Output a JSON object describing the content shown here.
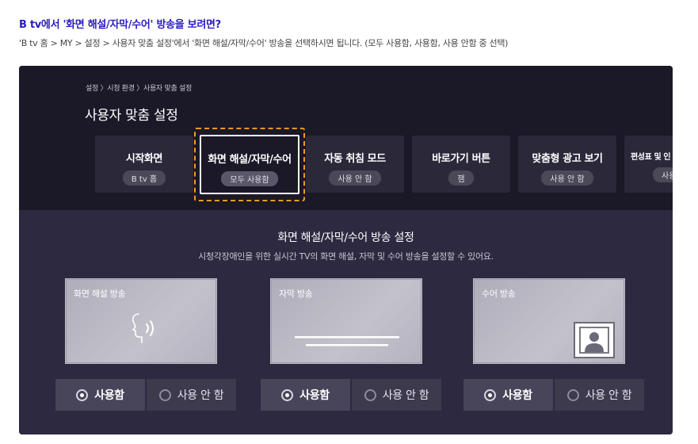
{
  "article": {
    "heading": "B tv에서 '화면 해설/자막/수어' 방송을 보려면?",
    "subtext": "'B tv 홈 > MY > 설정 > 사용자 맞춤 설정'에서 '화면 해설/자막/수어' 방송을 선택하시면 됩니다. (모두 사용함, 사용함, 사용 안함 중 선택)"
  },
  "tv": {
    "breadcrumb": "설정 〉시청 환경 〉사용자 맞춤 설정",
    "title": "사용자 맞춤 설정",
    "menu": [
      {
        "label": "시작화면",
        "value": "B tv 홈"
      },
      {
        "label": "화면 해설/자막/수어",
        "value": "모두 사용함"
      },
      {
        "label": "자동 취침 모드",
        "value": "사용 안 함"
      },
      {
        "label": "바로가기 버튼",
        "value": "잼"
      },
      {
        "label": "맞춤형 광고 보기",
        "value": "사용 안 함"
      },
      {
        "label": "편성표 및 인",
        "value": "사용"
      }
    ],
    "section_title": "화면 해설/자막/수어 방송 설정",
    "section_desc": "시청각장애인을 위한 실시간 TV의 화면 해설, 자막 및 수어 방송을 설정할 수 있어요.",
    "cards": [
      {
        "label": "화면 해설 방송",
        "icon": "speaking-head-icon"
      },
      {
        "label": "자막 방송",
        "icon": "subtitle-lines-icon"
      },
      {
        "label": "수어 방송",
        "icon": "sign-language-person-icon"
      }
    ],
    "options": {
      "on": "사용함",
      "off": "사용 안 함"
    }
  },
  "colors": {
    "heading": "#2a1cc0",
    "focus": "#f39a1c",
    "tv_bg": "#1d1a2b"
  }
}
